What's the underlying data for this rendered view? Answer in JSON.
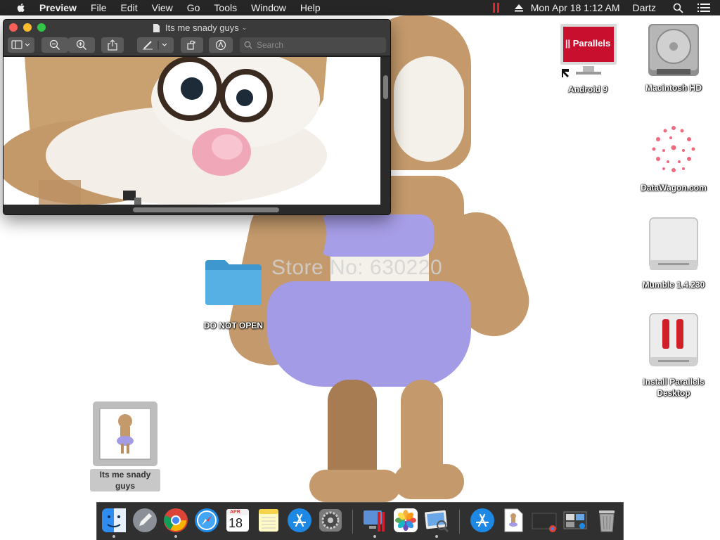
{
  "menubar": {
    "apple_icon": "apple-icon",
    "items": [
      "Preview",
      "File",
      "Edit",
      "View",
      "Go",
      "Tools",
      "Window",
      "Help"
    ],
    "clock": "Mon Apr 18  1:12 AM",
    "user": "Dartz",
    "status_icons": [
      "parallels-status-icon",
      "eject-icon",
      "search-icon",
      "list-icon"
    ]
  },
  "preview_window": {
    "title": "Its me snady guys",
    "toolbar": {
      "icons": [
        "sidebar-icon",
        "zoom-out-icon",
        "zoom-in-icon",
        "share-icon",
        "markup-pen-icon",
        "rotate-icon",
        "annotate-icon"
      ],
      "search_placeholder": "Search"
    }
  },
  "wallpaper": {
    "watermark": "Store No: 630220"
  },
  "desktop_icons": [
    {
      "id": "android9",
      "label": "Android 9"
    },
    {
      "id": "macintosh-hd",
      "label": "Macintosh HD"
    },
    {
      "id": "datawagon",
      "label": "DataWagon.com"
    },
    {
      "id": "mumble",
      "label": "Mumble 1.4.230"
    },
    {
      "id": "install-parallels",
      "label": "Install Parallels Desktop"
    },
    {
      "id": "do-not-open",
      "label": "DO NOT OPEN"
    },
    {
      "id": "its-me-snady",
      "label": "Its me snady guys"
    }
  ],
  "parallels_badge": "|| Parallels",
  "dock": {
    "items": [
      "Finder",
      "Launchpad",
      "Google Chrome",
      "Safari",
      "Calendar",
      "Notes",
      "App Store",
      "System Preferences",
      "Parallels Desktop",
      "Photos",
      "Preview",
      "Applications",
      "Its me snady guys",
      "Screenshot",
      "Mission Control",
      "Trash"
    ],
    "calendar_month": "APR",
    "calendar_day": "18"
  },
  "colors": {
    "menubar_bg": "#262626",
    "window_chrome": "#3a3a3a",
    "skirt": "#a49be6",
    "fur": "#c49a6c"
  }
}
